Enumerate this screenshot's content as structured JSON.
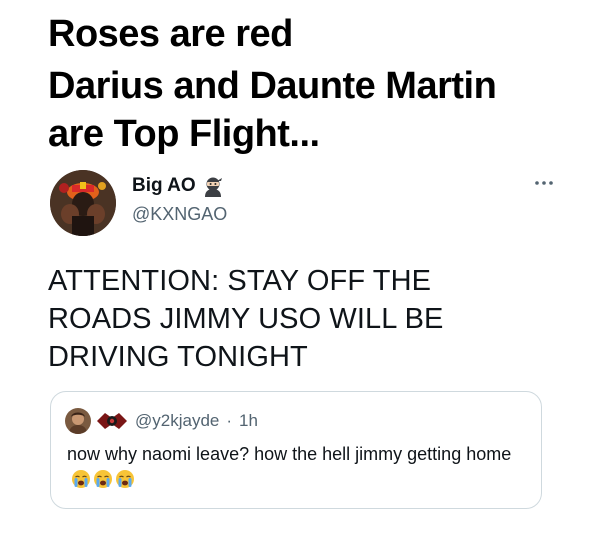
{
  "meme": {
    "line1": "Roses are red",
    "line2": "Darius and Daunte Martin",
    "line3": "are Top Flight..."
  },
  "tweet": {
    "display_name": "Big AO",
    "handle": "@KXNGAO",
    "text": "ATTENTION: STAY OFF THE ROADS JIMMY USO WILL BE DRIVING TONIGHT",
    "icons": {
      "name_emoji": "ninja-icon",
      "more": "more-icon"
    }
  },
  "quote": {
    "handle": "@y2kjayde",
    "separator": "·",
    "time": "1h",
    "text": "now why naomi leave? how the hell jimmy getting home",
    "emoji_count": 3,
    "emoji_name": "loudly-crying-face-icon"
  },
  "colors": {
    "text_primary": "#0f1419",
    "text_secondary": "#536471",
    "border": "#cfd9de",
    "background": "#ffffff"
  }
}
